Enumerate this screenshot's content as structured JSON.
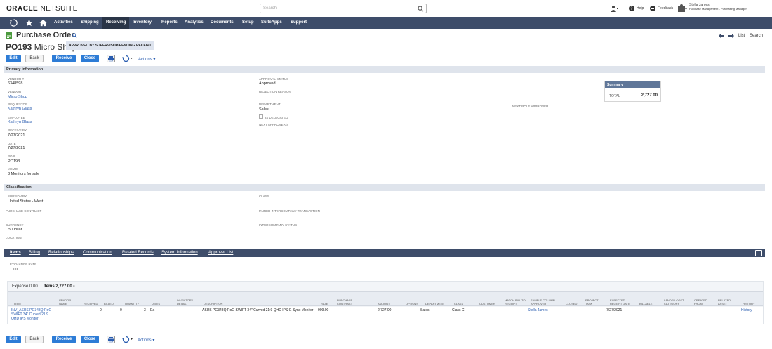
{
  "brand": {
    "name_bold": "ORACLE",
    "name_light": " NETSUITE"
  },
  "search": {
    "placeholder": "Search"
  },
  "topright": {
    "help": "Help",
    "feedback": "Feedback",
    "user_name": "Stella James",
    "user_role": "Purchase Management - Purchasing Manager"
  },
  "nav": {
    "items": [
      "Activities",
      "Shipping",
      "Receiving",
      "Inventory",
      "Reports",
      "Analytics",
      "Documents",
      "Setup",
      "SuiteApps",
      "Support"
    ],
    "active": "Receiving"
  },
  "header": {
    "title": "Purchase Order",
    "po_number": "PO193",
    "vendor_name": "Micro Shop",
    "status_badge": "APPROVED BY SUPERVISOR/PENDING RECEIPT",
    "nav_list": "List",
    "nav_search": "Search"
  },
  "buttons": {
    "edit": "Edit",
    "back": "Back",
    "receive": "Receive",
    "close": "Close",
    "actions": "Actions"
  },
  "primary": {
    "heading": "Primary Information",
    "vendor_num_label": "Vendor #",
    "vendor_num": "6348598",
    "vendor_label": "Vendor",
    "vendor": "Micro Shop",
    "requestor_label": "Requestor",
    "requestor": "Kathryn Glass",
    "employee_label": "Employee",
    "employee": "Kathryn Glass",
    "receive_by_label": "Receive By",
    "receive_by": "7/27/2021",
    "date_label": "Date",
    "date": "7/27/2021",
    "po_label": "PO #",
    "po": "PO193",
    "memo_label": "Memo",
    "memo": "3 Monitors for sale",
    "approval_status_label": "Approval Status",
    "approval_status": "Approved",
    "rejection_reason_label": "Rejection Reason",
    "department_label": "Department",
    "department": "Sales",
    "is_delegated_label": "Is Delegated",
    "next_approvers_label": "Next Approver/s",
    "next_role_approver_label": "Next Role Approver"
  },
  "summary": {
    "heading": "Summary",
    "total_label": "TOTAL",
    "total": "2,727.00"
  },
  "classification": {
    "heading": "Classification",
    "subsidiary_label": "Subsidiary",
    "subsidiary": "United States - West",
    "class_label": "Class",
    "purchase_contract_label": "Purchase Contract",
    "paired_label": "Paired Intercompany Transaction",
    "currency_label": "Currency",
    "currency": "US Dollar",
    "intercompany_status_label": "Intercompany Status",
    "location_label": "Location"
  },
  "subtabs": [
    "Items",
    "Billing",
    "Relationships",
    "Communication",
    "Related Records",
    "System Information",
    "Approver List"
  ],
  "items_tab": {
    "exchange_rate_label": "Exchange Rate",
    "exchange_rate": "1.00",
    "expense_tab": "Expense 0.00",
    "items_tab": "Items 2,727.00 •",
    "columns": [
      "Item",
      "Vendor Name",
      "Received",
      "Billed",
      "Quantity",
      "Units",
      "Inventory Detail",
      "Description",
      "Rate",
      "Purchase Contract",
      "Amount",
      "Options",
      "Department",
      "Class",
      "Customer",
      "Match Bill to Receipt",
      "Sample Column Approver",
      "Closed",
      "Project Task",
      "Expected Receipt Date",
      "Billable",
      "Landed Cost Category",
      "Created From",
      "Related Asset",
      "History"
    ],
    "row": {
      "item": "INV_ASUS PG348Q RoG SWIFT 34\" Curved 21:9 QHD IPS Monitor",
      "received": "0",
      "billed": "0",
      "quantity": "3",
      "units": "Ea",
      "description": "ASUS PG348Q RoG SWIFT 34\" Curved 21:9 QHD IPS G-Sync Monitor",
      "rate": "909.00",
      "amount": "2,727.00",
      "department": "Sales",
      "class": "Class C",
      "approver": "Stella James",
      "expected_date": "7/27/2021",
      "history": "History"
    }
  },
  "colors": {
    "nav_bg": "#3e4d6a",
    "nav_active": "#2a3547",
    "button_blue": "#2d7cd6",
    "section_bg": "#dfe4ec",
    "link": "#2a5db0"
  },
  "icons": [
    "search-icon",
    "home-icon",
    "star-icon",
    "recent-icon",
    "help-icon",
    "feedback-icon",
    "user-icon",
    "print-icon",
    "refresh-icon",
    "back-arrow-icon",
    "forward-arrow-icon",
    "collapse-icon"
  ]
}
